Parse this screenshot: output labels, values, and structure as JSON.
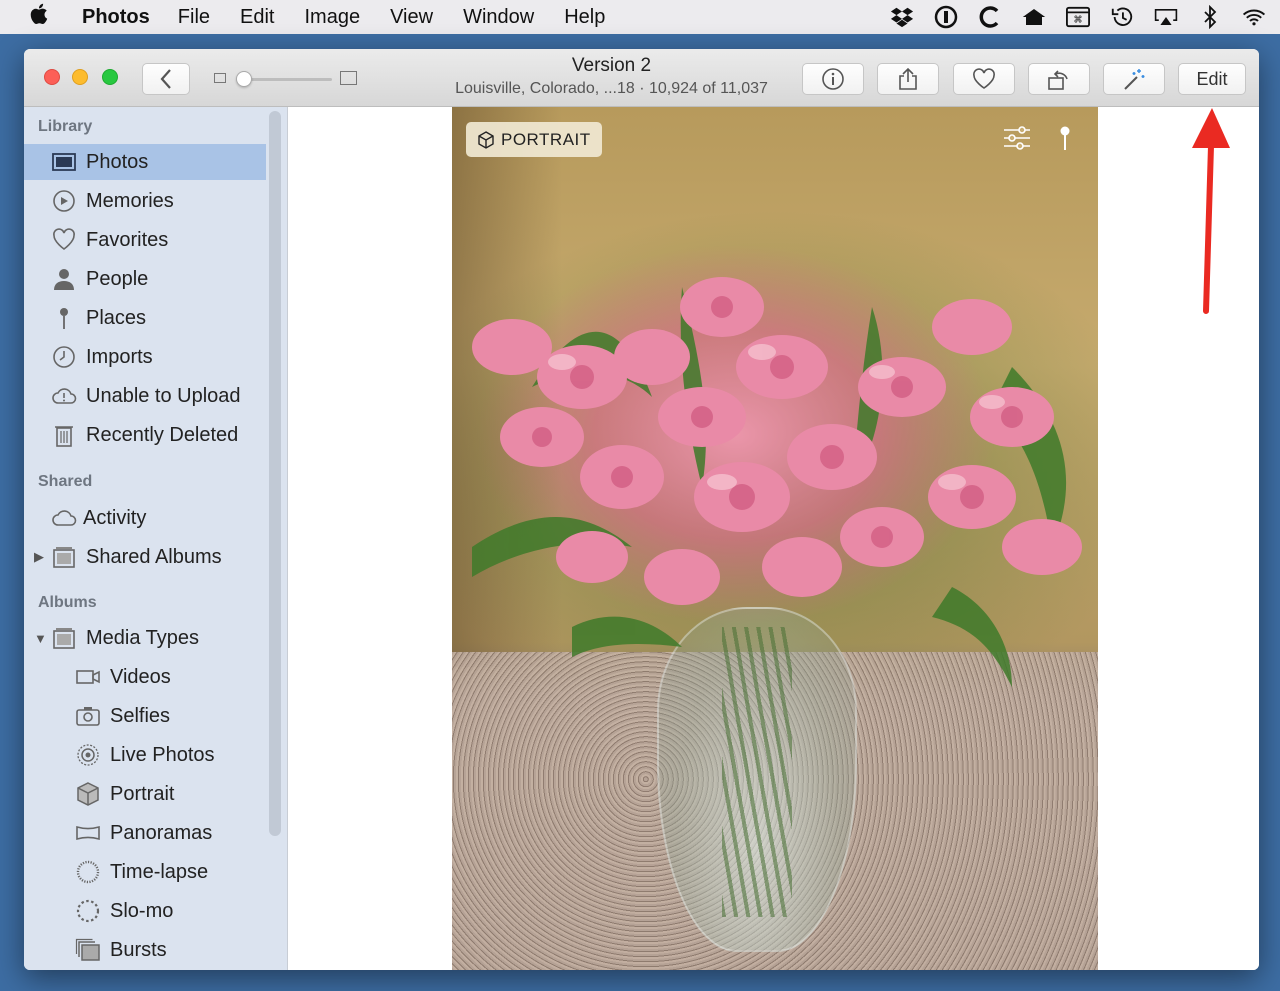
{
  "menubar": {
    "app_name": "Photos",
    "items": [
      "File",
      "Edit",
      "Image",
      "View",
      "Window",
      "Help"
    ]
  },
  "status_icons": [
    "dropbox-icon",
    "1password-icon",
    "c-app-icon",
    "home-icon",
    "keyboard-viewer-icon",
    "time-machine-icon",
    "airplay-icon",
    "bluetooth-icon",
    "wifi-icon"
  ],
  "window": {
    "title": "Version 2",
    "subtitle": "Louisville, Colorado, ...18  ·  10,924 of 11,037",
    "edit_label": "Edit"
  },
  "sidebar": {
    "sections": [
      {
        "title": "Library",
        "items": [
          {
            "label": "Photos",
            "icon": "photos-icon",
            "selected": true
          },
          {
            "label": "Memories",
            "icon": "memories-icon"
          },
          {
            "label": "Favorites",
            "icon": "heart-icon"
          },
          {
            "label": "People",
            "icon": "person-icon"
          },
          {
            "label": "Places",
            "icon": "pin-icon"
          },
          {
            "label": "Imports",
            "icon": "clock-icon"
          },
          {
            "label": "Unable to Upload",
            "icon": "cloud-alert-icon"
          },
          {
            "label": "Recently Deleted",
            "icon": "trash-icon"
          }
        ]
      },
      {
        "title": "Shared",
        "items": [
          {
            "label": "Activity",
            "icon": "cloud-icon"
          },
          {
            "label": "Shared Albums",
            "icon": "album-stack-icon",
            "disclosure": "collapsed"
          }
        ]
      },
      {
        "title": "Albums",
        "items": [
          {
            "label": "Media Types",
            "icon": "album-stack-icon",
            "disclosure": "expanded"
          },
          {
            "label": "Videos",
            "icon": "video-icon",
            "indent": 2
          },
          {
            "label": "Selfies",
            "icon": "selfie-icon",
            "indent": 2
          },
          {
            "label": "Live Photos",
            "icon": "live-photo-icon",
            "indent": 2
          },
          {
            "label": "Portrait",
            "icon": "cube-icon",
            "indent": 2
          },
          {
            "label": "Panoramas",
            "icon": "panorama-icon",
            "indent": 2
          },
          {
            "label": "Time-lapse",
            "icon": "timelapse-icon",
            "indent": 2
          },
          {
            "label": "Slo-mo",
            "icon": "slomo-icon",
            "indent": 2
          },
          {
            "label": "Bursts",
            "icon": "bursts-icon",
            "indent": 2
          }
        ]
      }
    ]
  },
  "photo": {
    "badge_label": "PORTRAIT"
  }
}
